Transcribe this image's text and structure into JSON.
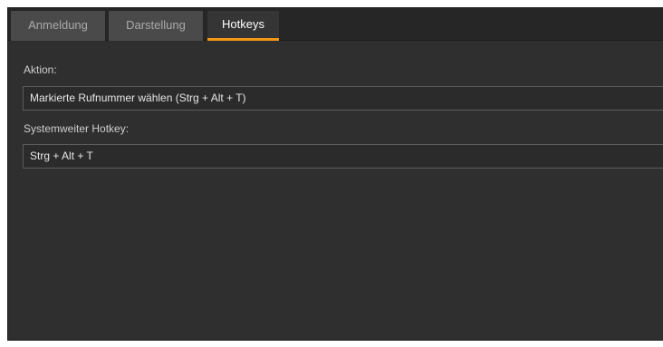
{
  "tabs": [
    {
      "label": "Anmeldung",
      "active": false
    },
    {
      "label": "Darstellung",
      "active": false
    },
    {
      "label": "Hotkeys",
      "active": true
    }
  ],
  "hotkeys_panel": {
    "action_label": "Aktion:",
    "action_value": "Markierte Rufnummer wählen (Strg + Alt + T)",
    "hotkey_label": "Systemweiter Hotkey:",
    "hotkey_value": "Strg + Alt + T"
  },
  "colors": {
    "background": "#2f2f2f",
    "active_tab_accent": "#f29a16",
    "inactive_tab": "#4a4a4a",
    "field_border": "#5c5c5c"
  }
}
